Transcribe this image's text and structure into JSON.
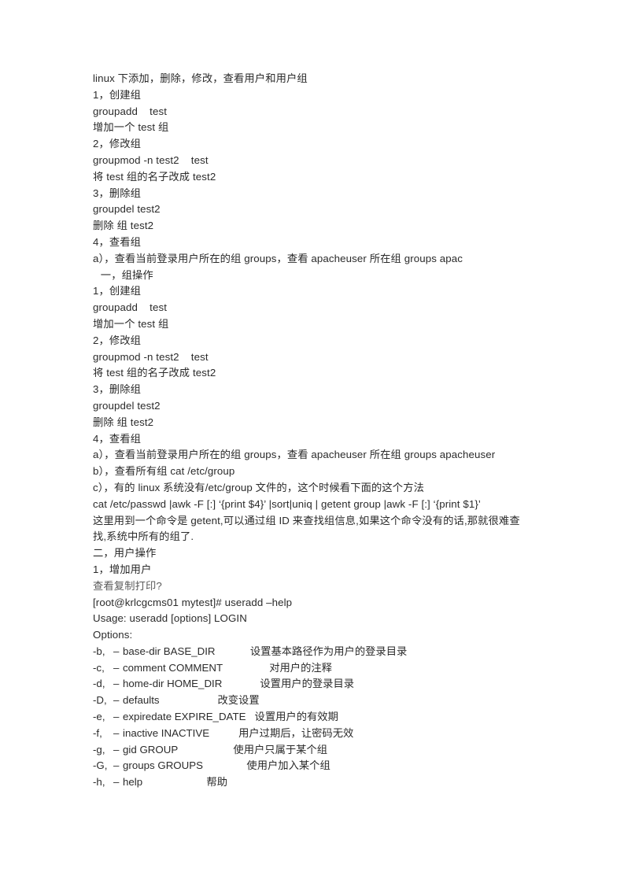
{
  "document": {
    "title": "linux 下添加，删除，修改，查看用户和用户组",
    "lines": [
      {
        "text": "linux 下添加，删除，修改，查看用户和用户组"
      },
      {
        "text": "1，创建组"
      },
      {
        "text": "groupadd    test"
      },
      {
        "text": "增加一个 test 组"
      },
      {
        "text": "2，修改组"
      },
      {
        "text": "groupmod -n test2    test"
      },
      {
        "text": "将 test 组的名子改成 test2"
      },
      {
        "text": "3，删除组"
      },
      {
        "text": "groupdel test2"
      },
      {
        "text": "删除 组 test2"
      },
      {
        "text": "4，查看组"
      },
      {
        "text": "a），查看当前登录用户所在的组 groups，查看 apacheuser 所在组 groups apac"
      },
      {
        "text": " 一，组操作",
        "indent": true
      },
      {
        "text": "1，创建组"
      },
      {
        "text": "groupadd    test"
      },
      {
        "text": "增加一个 test 组"
      },
      {
        "text": "2，修改组"
      },
      {
        "text": "groupmod -n test2    test"
      },
      {
        "text": "将 test 组的名子改成 test2"
      },
      {
        "text": "3，删除组"
      },
      {
        "text": "groupdel test2"
      },
      {
        "text": "删除 组 test2"
      },
      {
        "text": "4，查看组"
      },
      {
        "text": "a），查看当前登录用户所在的组 groups，查看 apacheuser 所在组 groups apacheuser"
      },
      {
        "text": "b），查看所有组 cat /etc/group"
      },
      {
        "text": "c），有的 linux 系统没有/etc/group 文件的，这个时候看下面的这个方法"
      },
      {
        "text": "cat /etc/passwd |awk -F [:] ‘{print $4}’ |sort|uniq | getent group |awk -F [:] ‘{print $1}’"
      },
      {
        "text": "这里用到一个命令是 getent,可以通过组 ID 来查找组信息,如果这个命令没有的话,那就很难查找,系统中所有的组了.",
        "wrap": true
      },
      {
        "text": "二，用户操作"
      },
      {
        "text": "1，增加用户"
      },
      {
        "text": "查看复制打印?",
        "muted": true
      },
      {
        "text": "[root@krlcgcms01 mytest]# useradd –help"
      },
      {
        "text": "Usage: useradd [options] LOGIN"
      },
      {
        "text": "Options:"
      }
    ],
    "useradd_options": [
      {
        "flag": "-b,",
        "dash": "–",
        "name": "base-dir BASE_DIR",
        "desc": "设置基本路径作为用户的登录目录",
        "pad": 12
      },
      {
        "flag": "-c,",
        "dash": "–",
        "name": "comment COMMENT",
        "desc": "对用户的注释",
        "pad": 16
      },
      {
        "flag": "-d,",
        "dash": "–",
        "name": "home-dir HOME_DIR",
        "desc": "设置用户的登录目录",
        "pad": 13
      },
      {
        "flag": "-D,",
        "dash": "–",
        "name": "defaults",
        "desc": "改变设置",
        "pad": 20
      },
      {
        "flag": "-e,",
        "dash": "–",
        "name": "expiredate EXPIRE_DATE",
        "desc": "设置用户的有效期",
        "pad": 3
      },
      {
        "flag": "-f,",
        "dash": "–",
        "name": "inactive INACTIVE",
        "desc": "用户过期后，让密码无效",
        "pad": 10
      },
      {
        "flag": "-g,",
        "dash": "–",
        "name": "gid GROUP",
        "desc": "使用户只属于某个组",
        "pad": 19
      },
      {
        "flag": "-G,",
        "dash": "–",
        "name": "groups GROUPS",
        "desc": "使用户加入某个组",
        "pad": 15
      },
      {
        "flag": "-h,",
        "dash": "–",
        "name": "help",
        "desc": "帮助",
        "pad": 22
      }
    ]
  }
}
